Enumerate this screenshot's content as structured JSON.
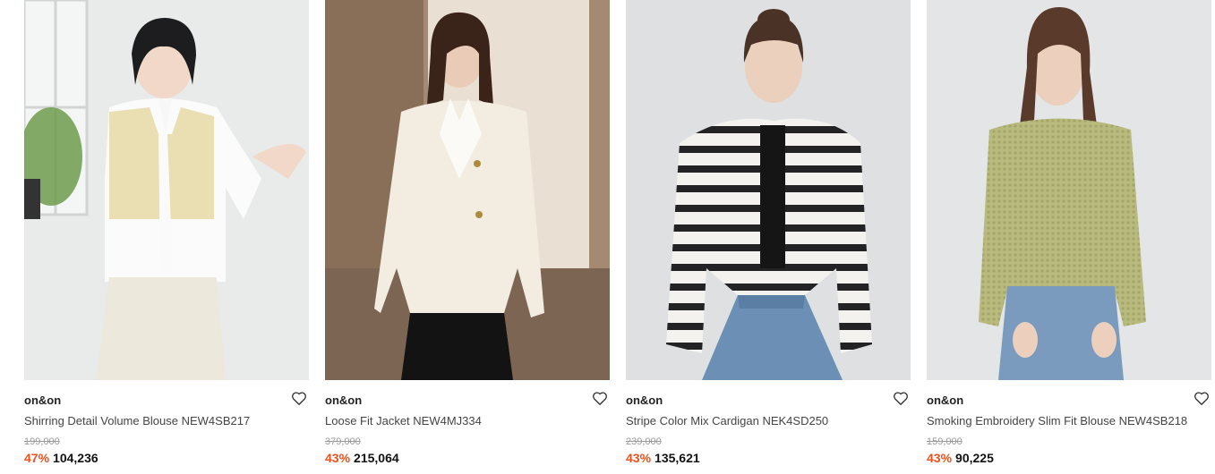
{
  "products": [
    {
      "brand": "on&on",
      "name": "Shirring Detail Volume Blouse NEW4SB217",
      "original_price": "199,000",
      "discount": "47%",
      "sale_price": "104,236",
      "wishlist_icon": "heart-outline-icon"
    },
    {
      "brand": "on&on",
      "name": "Loose Fit Jacket NEW4MJ334",
      "original_price": "379,000",
      "discount": "43%",
      "sale_price": "215,064",
      "wishlist_icon": "heart-outline-icon"
    },
    {
      "brand": "on&on",
      "name": "Stripe Color Mix Cardigan NEK4SD250",
      "original_price": "239,000",
      "discount": "43%",
      "sale_price": "135,621",
      "wishlist_icon": "heart-outline-icon"
    },
    {
      "brand": "on&on",
      "name": "Smoking Embroidery Slim Fit Blouse NEW4SB218",
      "original_price": "159,000",
      "discount": "43%",
      "sale_price": "90,225",
      "wishlist_icon": "heart-outline-icon"
    }
  ],
  "colors": {
    "discount": "#f0501e",
    "original_price": "#999999",
    "brand": "#222222"
  }
}
